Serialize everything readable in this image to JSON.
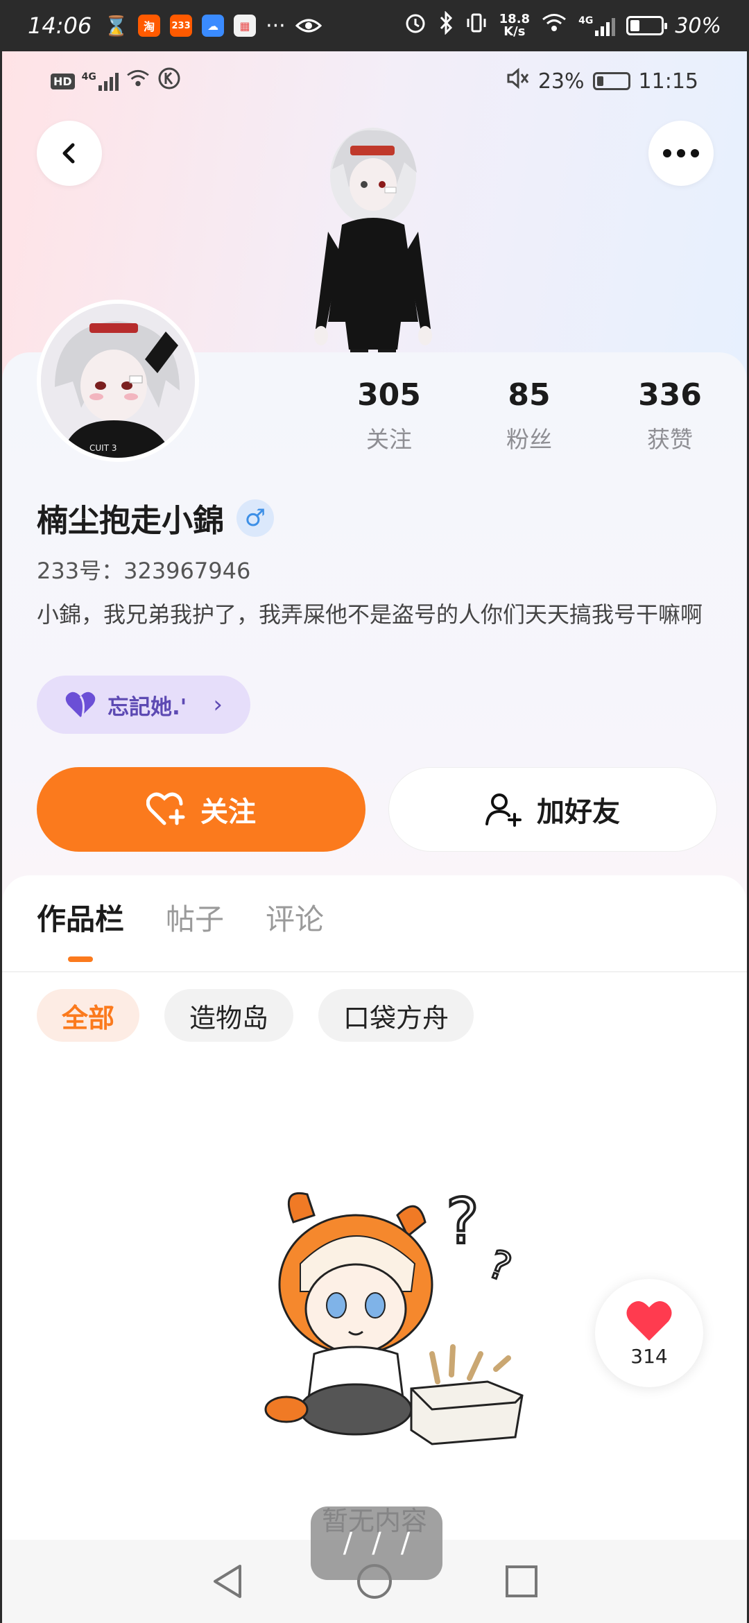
{
  "outer_status": {
    "time": "14:06",
    "apps": [
      {
        "name": "hourglass-icon",
        "label": "⌛"
      },
      {
        "name": "taobao-app-icon",
        "label": "淘",
        "color": "#ff5a00"
      },
      {
        "name": "app-233-icon",
        "label": "233",
        "color": "#ff5a00"
      },
      {
        "name": "cloud-app-icon",
        "label": "☁",
        "color": "#3a8bff"
      },
      {
        "name": "calendar-app-icon",
        "label": "▦",
        "color": "#e94b4b"
      }
    ],
    "more": "···",
    "net_speed_value": "18.8",
    "net_speed_unit": "K/s",
    "network": "4G",
    "battery_text": "30%",
    "battery_level": 0.3
  },
  "inner_status": {
    "hd": "HD",
    "network": "4G",
    "battery_percent": "23%",
    "battery_level": 0.23,
    "time": "11:15"
  },
  "profile": {
    "name": "楠尘抱走小錦",
    "gender_symbol": "♂",
    "uid_label": "233号：",
    "uid": "323967946",
    "bio": "小錦，我兄弟我护了，我弄屎他不是盗号的人你们天天搞我号干嘛啊",
    "tag": "忘記她.'"
  },
  "stats": [
    {
      "value": "305",
      "label": "关注"
    },
    {
      "value": "85",
      "label": "粉丝"
    },
    {
      "value": "336",
      "label": "获赞"
    }
  ],
  "actions": {
    "follow": "关注",
    "add_friend": "加好友"
  },
  "tabs": [
    "作品栏",
    "帖子",
    "评论"
  ],
  "active_tab": 0,
  "filters": [
    "全部",
    "造物岛",
    "口袋方舟"
  ],
  "empty_text": "暂无内容",
  "like_fab": {
    "count": "314"
  },
  "overlay_marks": [
    "/",
    "/",
    "/"
  ],
  "colors": {
    "accent": "#fb7a1d",
    "tag_bg": "#e6defa",
    "tag_text": "#5d4ab3",
    "gender": "#3d8fe6",
    "heart": "#ff3b4f"
  }
}
